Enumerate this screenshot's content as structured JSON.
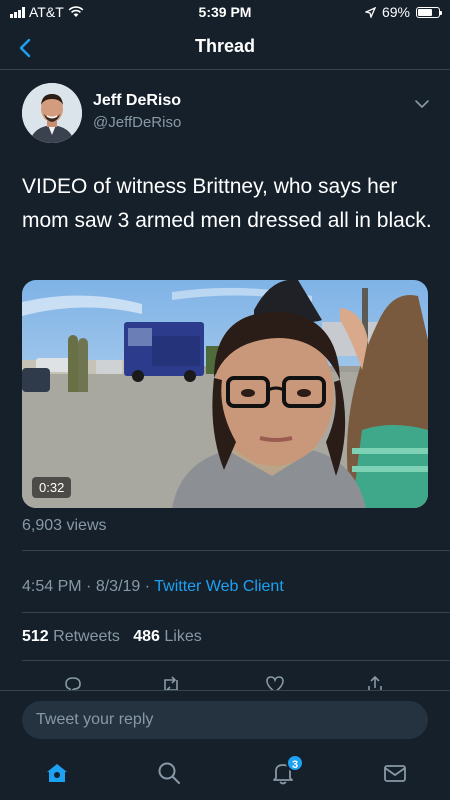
{
  "status_bar": {
    "carrier": "AT&T",
    "time": "5:39 PM",
    "battery": "69%",
    "battery_level": 0.69
  },
  "nav": {
    "title": "Thread"
  },
  "tweet": {
    "author_name": "Jeff DeRiso",
    "author_handle": "@JeffDeRiso",
    "text": "VIDEO of witness Brittney, who says her mom saw 3 armed men dressed all in black.",
    "video_duration": "0:32",
    "views": "6,903 views",
    "time": "4:54 PM",
    "date": "8/3/19",
    "separator": "·",
    "client": "Twitter Web Client",
    "retweet_count": "512",
    "retweet_label": "Retweets",
    "like_count": "486",
    "like_label": "Likes"
  },
  "reply": {
    "placeholder": "Tweet your reply"
  },
  "tab_bar": {
    "notification_badge": "3"
  },
  "colors": {
    "background": "#15202b",
    "accent": "#1da1f2",
    "secondary_text": "#8899a6",
    "divider": "#38444d"
  }
}
